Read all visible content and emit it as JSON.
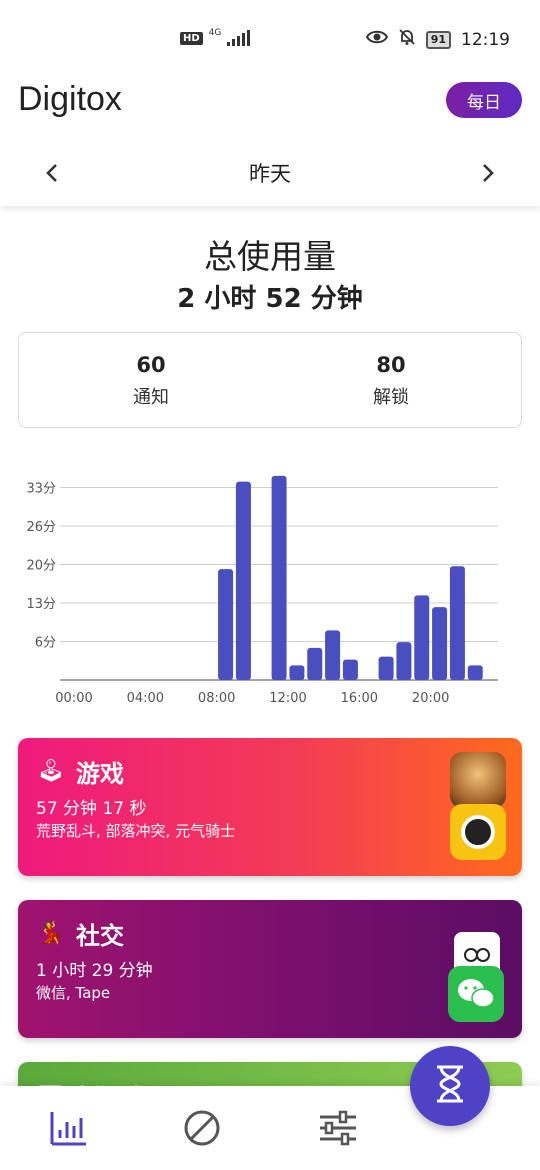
{
  "status_bar": {
    "hd": "HD",
    "network": "4G",
    "battery": "91",
    "time": "12:19"
  },
  "header": {
    "title": "Digitox",
    "period_button": "每日"
  },
  "date_nav": {
    "label": "昨天"
  },
  "summary": {
    "title": "总使用量",
    "value": "2 小时 52 分钟",
    "notifications": {
      "value": "60",
      "label": "通知"
    },
    "unlocks": {
      "value": "80",
      "label": "解锁"
    }
  },
  "chart_data": {
    "type": "bar",
    "title": "",
    "xlabel": "",
    "ylabel": "",
    "x": [
      0,
      1,
      2,
      3,
      4,
      5,
      6,
      7,
      8,
      9,
      10,
      11,
      12,
      13,
      14,
      15,
      16,
      17,
      18,
      19,
      20,
      21,
      22,
      23
    ],
    "values": [
      0,
      0,
      0,
      0,
      0,
      0,
      0,
      0,
      19,
      34,
      0,
      35,
      2.5,
      5.5,
      8.5,
      3.5,
      0,
      4,
      6.5,
      14.5,
      12.5,
      19.5,
      2.5,
      0
    ],
    "yunit": "分",
    "ylim": [
      0,
      36
    ],
    "yticks": [
      "6分",
      "13分",
      "20分",
      "26分",
      "33分"
    ],
    "ytick_values": [
      6.6,
      13.2,
      19.8,
      26.4,
      33
    ],
    "xticks": [
      "00:00",
      "04:00",
      "08:00",
      "12:00",
      "16:00",
      "20:00"
    ],
    "grid": true,
    "color": "#4a4fbf"
  },
  "categories": [
    {
      "name": "游戏",
      "emoji": "🕹",
      "time": "57 分钟 17 秒",
      "apps": "荒野乱斗, 部落冲突, 元气骑士"
    },
    {
      "name": "社交",
      "emoji": "💃",
      "time": "1 小时 29 分钟",
      "apps": "微信, Tape"
    },
    {
      "name": "新闻资讯",
      "emoji": "📰"
    }
  ],
  "icons": {
    "nav_stats": "bar-chart-icon",
    "nav_block": "block-icon",
    "nav_settings": "sliders-icon",
    "fab": "hourglass-icon"
  },
  "colors": {
    "accent": "#4e42c7",
    "bar": "#4a4fbf",
    "daily_button": "#7b1fa2"
  }
}
